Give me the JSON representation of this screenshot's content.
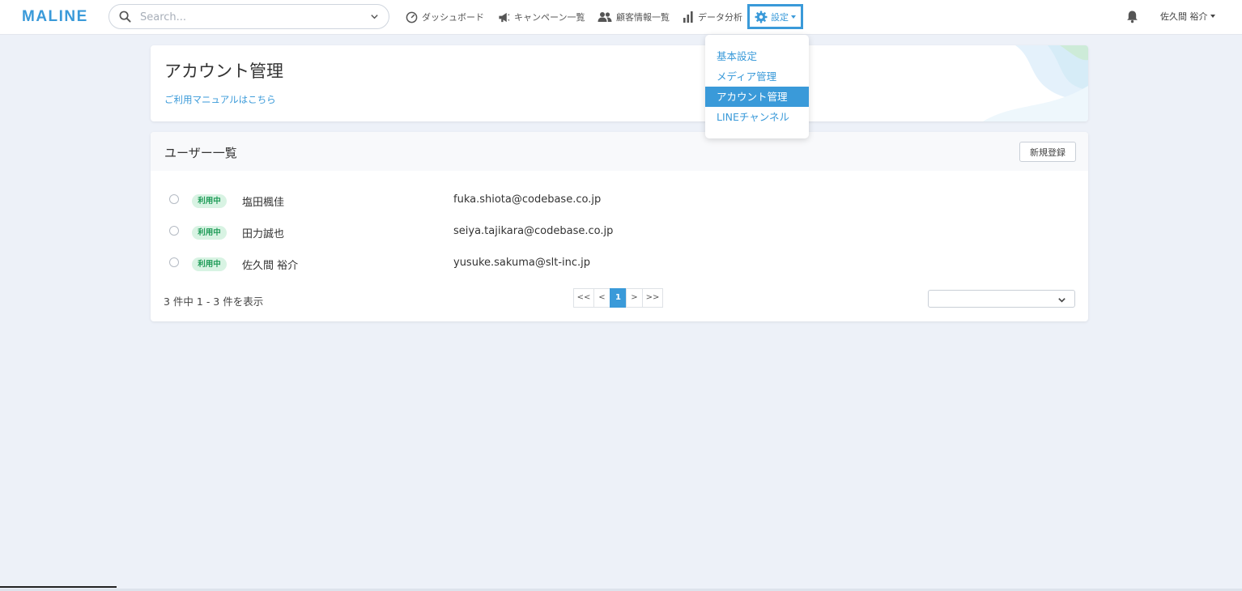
{
  "app": {
    "logo": "MALINE"
  },
  "search": {
    "placeholder": "Search..."
  },
  "nav": {
    "dashboard": "ダッシュボード",
    "campaigns": "キャンペーン一覧",
    "customers": "顧客情報一覧",
    "analytics": "データ分析",
    "settings": "設定",
    "user": "佐久間 裕介"
  },
  "settings_menu": {
    "items": [
      "基本設定",
      "メディア管理",
      "アカウント管理",
      "LINEチャンネル"
    ],
    "active": "アカウント管理"
  },
  "page": {
    "title": "アカウント管理",
    "manual_link": "ご利用マニュアルはこちら"
  },
  "users": {
    "title": "ユーザー一覧",
    "new_button": "新規登録",
    "rows": [
      {
        "status": "利用中",
        "name": "塩田楓佳",
        "email": "fuka.shiota@codebase.co.jp"
      },
      {
        "status": "利用中",
        "name": "田力誠也",
        "email": "seiya.tajikara@codebase.co.jp"
      },
      {
        "status": "利用中",
        "name": "佐久間 裕介",
        "email": "yusuke.sakuma@slt-inc.jp"
      }
    ],
    "count_text": "3 件中 1 - 3 件を表示",
    "pagination": {
      "first": "<<",
      "prev": "<",
      "current": "1",
      "next": ">",
      "last": ">>"
    },
    "per_page_value": ""
  },
  "colors": {
    "accent": "#3a9ad9",
    "status_badge_bg": "#d8f3e3",
    "status_badge_text": "#1e9b57",
    "background": "#edf1f8"
  },
  "icons": {
    "search": "search-icon",
    "dashboard": "speedometer-icon",
    "campaigns": "megaphone-icon",
    "customers": "people-icon",
    "analytics": "bar-chart-icon",
    "settings": "gear-icon",
    "notifications": "bell-icon"
  }
}
